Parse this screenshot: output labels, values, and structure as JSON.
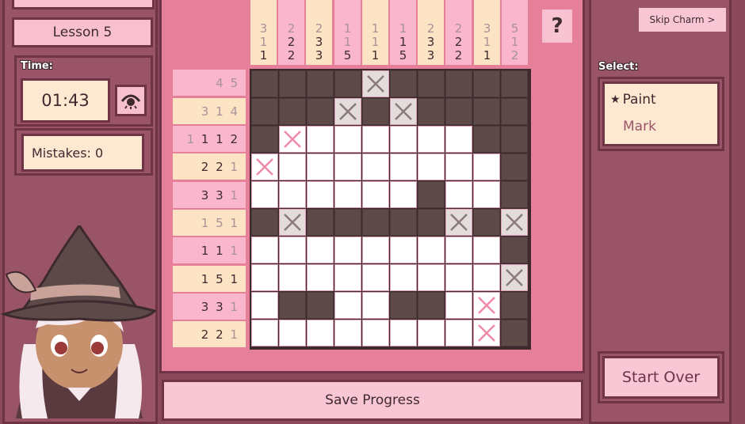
{
  "lesson": "Lesson 5",
  "time_label": "Time:",
  "timer": "01:43",
  "mistakes": "Mistakes: 0",
  "skip_button": "Skip Charm >",
  "help_button": "?",
  "select_label": "Select:",
  "tools": {
    "paint": "Paint",
    "mark": "Mark",
    "selected": "Paint"
  },
  "start_over": "Start Over",
  "save_progress": "Save Progress",
  "column_clues": [
    [
      "3",
      "1",
      "1"
    ],
    [
      "2",
      "2",
      "2"
    ],
    [
      "2",
      "3",
      "3"
    ],
    [
      "1",
      "1",
      "5"
    ],
    [
      "1",
      "1",
      "1"
    ],
    [
      "1",
      "1",
      "5"
    ],
    [
      "2",
      "3",
      "3"
    ],
    [
      "2",
      "2",
      "2"
    ],
    [
      "3",
      "1",
      "1"
    ],
    [
      "5",
      "1",
      "2"
    ]
  ],
  "column_clue_solved": [
    [
      true,
      true,
      false
    ],
    [
      true,
      false,
      false
    ],
    [
      true,
      false,
      false
    ],
    [
      true,
      true,
      false
    ],
    [
      true,
      true,
      true
    ],
    [
      true,
      false,
      false
    ],
    [
      true,
      false,
      false
    ],
    [
      true,
      true,
      false
    ],
    [
      true,
      true,
      false
    ],
    [
      true,
      true,
      true
    ]
  ],
  "row_clues": [
    [
      "4",
      "5"
    ],
    [
      "3",
      "1",
      "4"
    ],
    [
      "1",
      "1",
      "1",
      "2"
    ],
    [
      "2",
      "2",
      "1"
    ],
    [
      "3",
      "3",
      "1"
    ],
    [
      "1",
      "5",
      "1"
    ],
    [
      "1",
      "1",
      "1"
    ],
    [
      "1",
      "5",
      "1"
    ],
    [
      "3",
      "3",
      "1"
    ],
    [
      "2",
      "2",
      "1"
    ]
  ],
  "row_clue_solved": [
    [
      true,
      true
    ],
    [
      true,
      true,
      true
    ],
    [
      true,
      false,
      false,
      false
    ],
    [
      false,
      false,
      true
    ],
    [
      false,
      false,
      true
    ],
    [
      true,
      true,
      true
    ],
    [
      false,
      false,
      true
    ],
    [
      false,
      false,
      false
    ],
    [
      false,
      false,
      true
    ],
    [
      false,
      false,
      true
    ]
  ],
  "grid": [
    "FFFFXFFFFF",
    "FFFXFXFFFF",
    "FWEEEEEEFF",
    "WEEEEEEEEF",
    "EEEEEEFEEF",
    "FXFFFFFXFX",
    "EEEEEEEEEF",
    "EEEEEEEEEX",
    "EFFEEFFEWF",
    "EEEEEEEEWF"
  ],
  "colors": {
    "filled": "#5e4a49",
    "accent": "#f8bfd0",
    "cream": "#fde9d2",
    "frame": "#6e3446"
  }
}
